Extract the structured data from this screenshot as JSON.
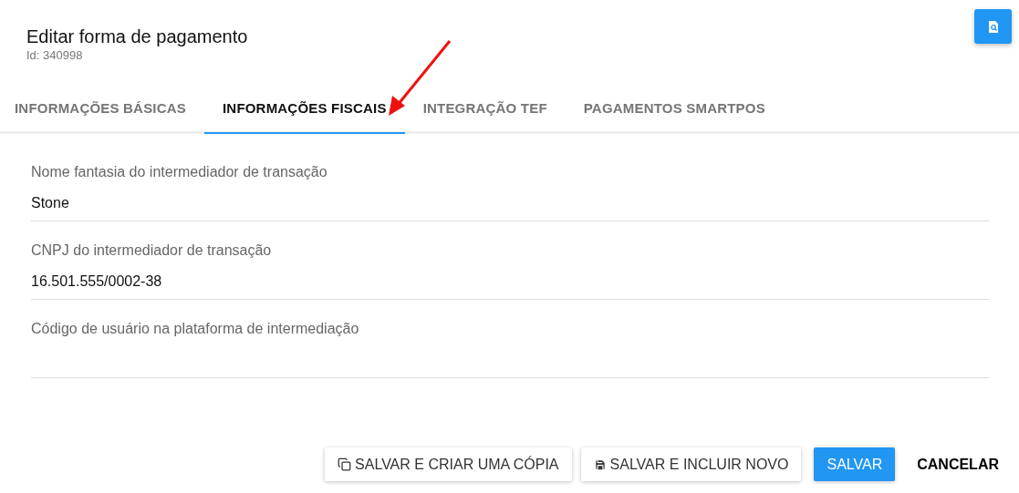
{
  "header": {
    "title": "Editar forma de pagamento",
    "subtitle": "Id: 340998"
  },
  "tabs": [
    {
      "label": "INFORMAÇÕES BÁSICAS",
      "selected": false
    },
    {
      "label": "INFORMAÇÕES FISCAIS",
      "selected": true
    },
    {
      "label": "INTEGRAÇÃO TEF",
      "selected": false
    },
    {
      "label": "PAGAMENTOS SMARTPOS",
      "selected": false
    }
  ],
  "fields": [
    {
      "label": "Nome fantasia do intermediador de transação",
      "value": "Stone"
    },
    {
      "label": "CNPJ do intermediador de transação",
      "value": "16.501.555/0002-38"
    },
    {
      "label": "Código de usuário na plataforma de intermediação"
    }
  ],
  "buttons": [
    {
      "label": "SALVAR E CRIAR UMA CÓPIA",
      "kind": "copy"
    },
    {
      "label": "SALVAR E INCLUIR NOVO",
      "kind": "save"
    },
    {
      "label": "SALVAR",
      "kind": "primary"
    },
    {
      "label": "CANCELAR",
      "kind": "text"
    }
  ]
}
